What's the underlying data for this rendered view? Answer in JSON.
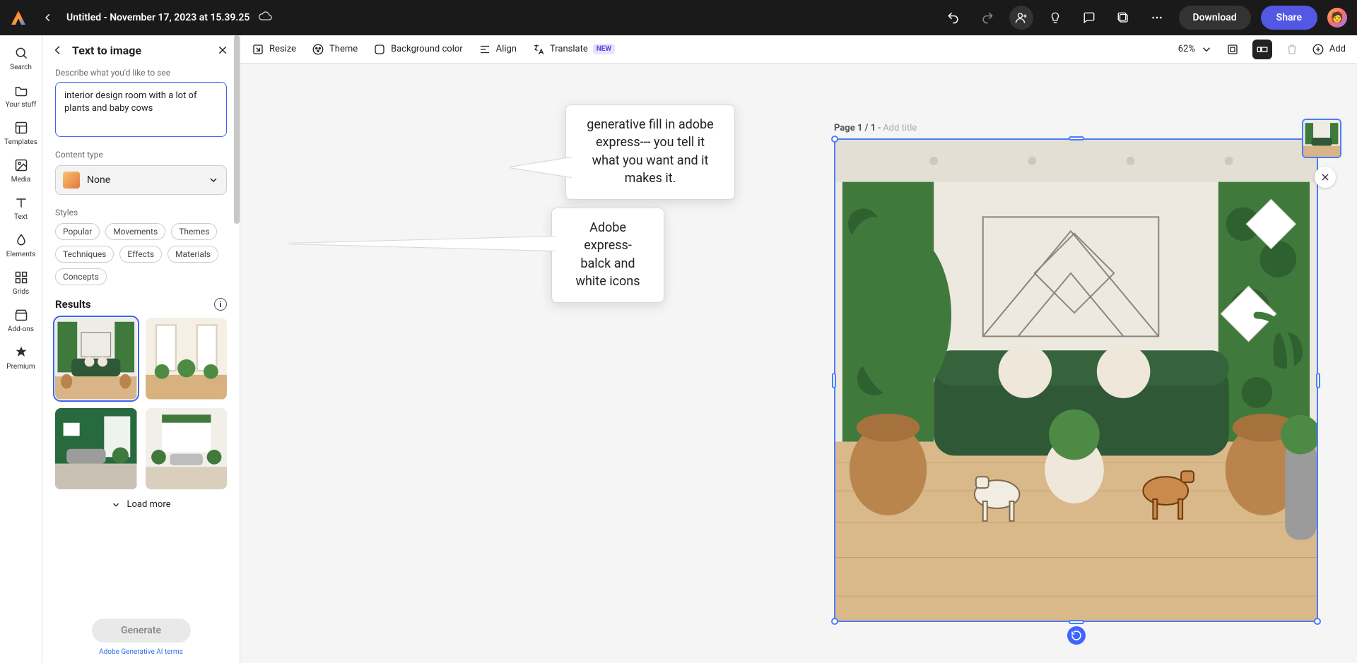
{
  "topbar": {
    "doc_title": "Untitled - November 17, 2023 at 15.39.25",
    "download": "Download",
    "share": "Share"
  },
  "rail": [
    {
      "id": "search",
      "label": "Search"
    },
    {
      "id": "your-stuff",
      "label": "Your stuff"
    },
    {
      "id": "templates",
      "label": "Templates"
    },
    {
      "id": "media",
      "label": "Media"
    },
    {
      "id": "text",
      "label": "Text"
    },
    {
      "id": "elements",
      "label": "Elements"
    },
    {
      "id": "grids",
      "label": "Grids"
    },
    {
      "id": "addons",
      "label": "Add-ons"
    },
    {
      "id": "premium",
      "label": "Premium"
    }
  ],
  "panel": {
    "title": "Text to image",
    "describe_label": "Describe what you'd like to see",
    "prompt": "interior design room with a lot of plants and baby cows",
    "content_type_label": "Content type",
    "content_type_value": "None",
    "styles_label": "Styles",
    "style_chips": [
      "Popular",
      "Movements",
      "Themes",
      "Techniques",
      "Effects",
      "Materials",
      "Concepts"
    ],
    "results_label": "Results",
    "load_more": "Load more",
    "generate": "Generate",
    "terms": "Adobe Generative AI terms"
  },
  "ctx": {
    "resize": "Resize",
    "theme": "Theme",
    "bgcolor": "Background color",
    "align": "Align",
    "translate": "Translate",
    "translate_badge": "NEW",
    "zoom": "62%",
    "add": "Add"
  },
  "callouts": {
    "c1": "generative fill in adobe express--- you tell it what you want and it makes it.",
    "c2": "Adobe express- balck and white icons"
  },
  "page": {
    "prefix": "Page 1 / 1",
    "sep": " - ",
    "placeholder": "Add title"
  }
}
